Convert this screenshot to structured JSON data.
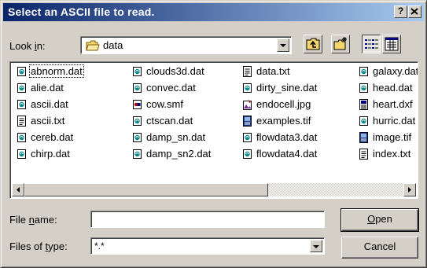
{
  "dialog": {
    "title": "Select an ASCII file to read.",
    "help_label": "?",
    "close_label": "✕"
  },
  "look_in": {
    "label_pre": "Look ",
    "label_key": "i",
    "label_post": "n:",
    "value": "data"
  },
  "files": [
    {
      "name": "abnorm.dat",
      "icon": "data-file-icon",
      "selected": true
    },
    {
      "name": "alie.dat",
      "icon": "data-file-icon"
    },
    {
      "name": "ascii.dat",
      "icon": "data-file-icon"
    },
    {
      "name": "ascii.txt",
      "icon": "text-file-icon"
    },
    {
      "name": "cereb.dat",
      "icon": "data-file-icon"
    },
    {
      "name": "chirp.dat",
      "icon": "data-file-icon"
    },
    {
      "name": "clouds3d.dat",
      "icon": "data-file-icon"
    },
    {
      "name": "convec.dat",
      "icon": "data-file-icon"
    },
    {
      "name": "cow.smf",
      "icon": "smf-file-icon"
    },
    {
      "name": "ctscan.dat",
      "icon": "data-file-icon"
    },
    {
      "name": "damp_sn.dat",
      "icon": "data-file-icon"
    },
    {
      "name": "damp_sn2.dat",
      "icon": "data-file-icon"
    },
    {
      "name": "data.txt",
      "icon": "text-file-icon"
    },
    {
      "name": "dirty_sine.dat",
      "icon": "data-file-icon"
    },
    {
      "name": "endocell.jpg",
      "icon": "image-file-icon"
    },
    {
      "name": "examples.tif",
      "icon": "tif-file-icon"
    },
    {
      "name": "flowdata3.dat",
      "icon": "data-file-icon"
    },
    {
      "name": "flowdata4.dat",
      "icon": "data-file-icon"
    },
    {
      "name": "galaxy.dat",
      "icon": "data-file-icon"
    },
    {
      "name": "head.dat",
      "icon": "data-file-icon"
    },
    {
      "name": "heart.dxf",
      "icon": "dxf-file-icon"
    },
    {
      "name": "hurric.dat",
      "icon": "data-file-icon"
    },
    {
      "name": "image.tif",
      "icon": "tif-file-icon"
    },
    {
      "name": "index.txt",
      "icon": "text-file-icon"
    }
  ],
  "file_name": {
    "label_pre": "File ",
    "label_key": "n",
    "label_post": "ame:",
    "value": ""
  },
  "file_type": {
    "label_pre": "Files of ",
    "label_key": "t",
    "label_post": "ype:",
    "value": "*.*"
  },
  "buttons": {
    "open_key": "O",
    "open_rest": "pen",
    "cancel": "Cancel"
  }
}
